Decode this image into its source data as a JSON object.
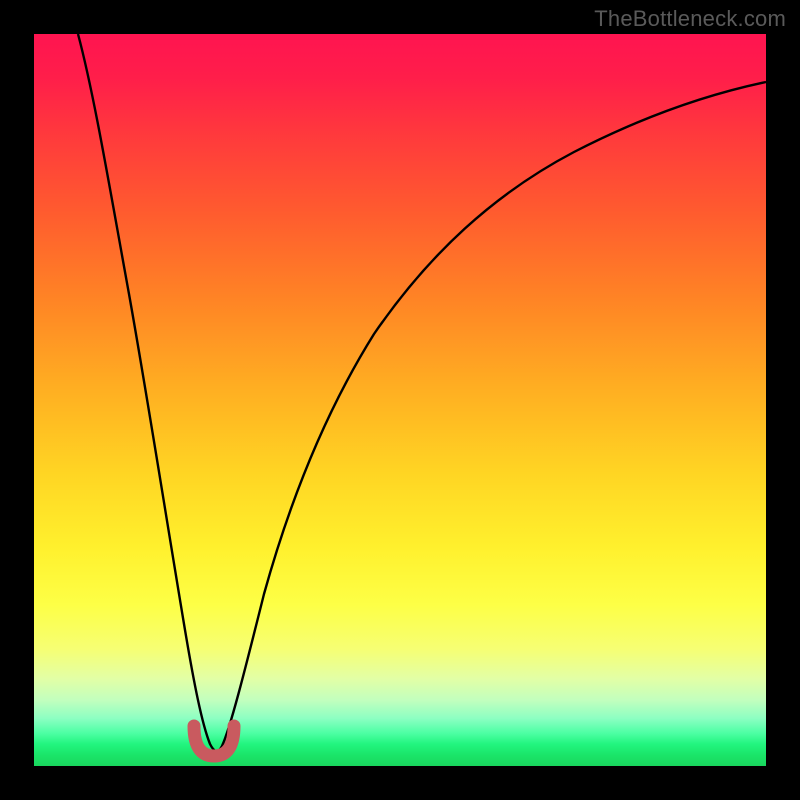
{
  "watermark": "TheBottleneck.com",
  "colors": {
    "frame": "#000000",
    "curve": "#000000",
    "marker": "#c95a5f"
  },
  "chart_data": {
    "type": "line",
    "title": "",
    "xlabel": "",
    "ylabel": "",
    "xlim": [
      0,
      100
    ],
    "ylim": [
      0,
      100
    ],
    "grid": false,
    "series": [
      {
        "name": "bottleneck-curve",
        "x": [
          6,
          8,
          10,
          12,
          14,
          16,
          18,
          20,
          22,
          23,
          24,
          25,
          26,
          28,
          30,
          33,
          37,
          42,
          48,
          55,
          63,
          72,
          82,
          92,
          100
        ],
        "y": [
          100,
          88,
          76,
          64,
          52,
          40,
          29,
          18,
          8,
          4,
          2,
          2,
          4,
          10,
          19,
          29,
          40,
          50,
          59,
          67,
          74,
          79,
          83,
          86,
          88
        ]
      }
    ],
    "annotations": [
      {
        "name": "trough-marker",
        "shape": "u",
        "x": 24.5,
        "y": 2,
        "width": 5
      }
    ]
  }
}
